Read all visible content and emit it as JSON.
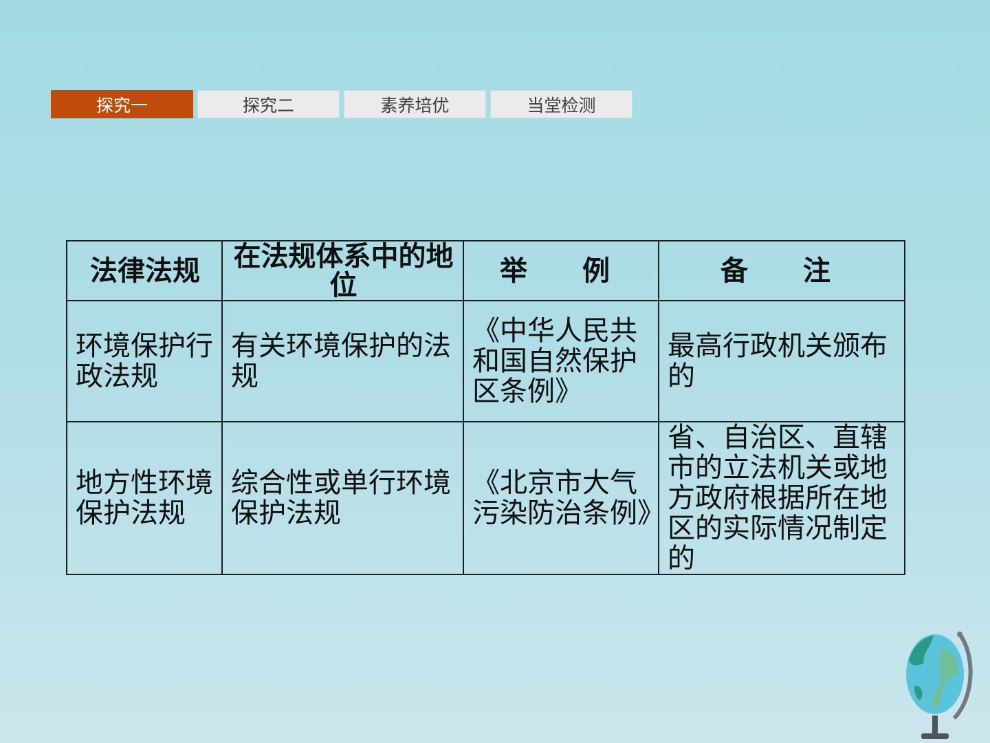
{
  "nav": {
    "tabs": [
      {
        "label": "探究一",
        "active": true
      },
      {
        "label": "探究二",
        "active": false
      },
      {
        "label": "素养培优",
        "active": false
      },
      {
        "label": "当堂检测",
        "active": false
      }
    ]
  },
  "table": {
    "headers": [
      "法律法规",
      "在法规体系中的地位",
      "举　例",
      "备　注"
    ],
    "rows": [
      [
        "环境保护行政法规",
        "有关环境保护的法规",
        "《中华人民共和国自然保护区条例》",
        "最高行政机关颁布的"
      ],
      [
        "地方性环境保护法规",
        "综合性或单行环境保护法规",
        "《北京市大气污染防治条例》",
        "省、自治区、直辖市的立法机关或地方政府根据所在地区的实际情况制定的"
      ]
    ]
  },
  "colors": {
    "active_tab": "#c14b0a",
    "inactive_tab": "#ebebeb",
    "background": "#a2dbe5"
  },
  "icons": {
    "decoration": "globe-icon"
  }
}
